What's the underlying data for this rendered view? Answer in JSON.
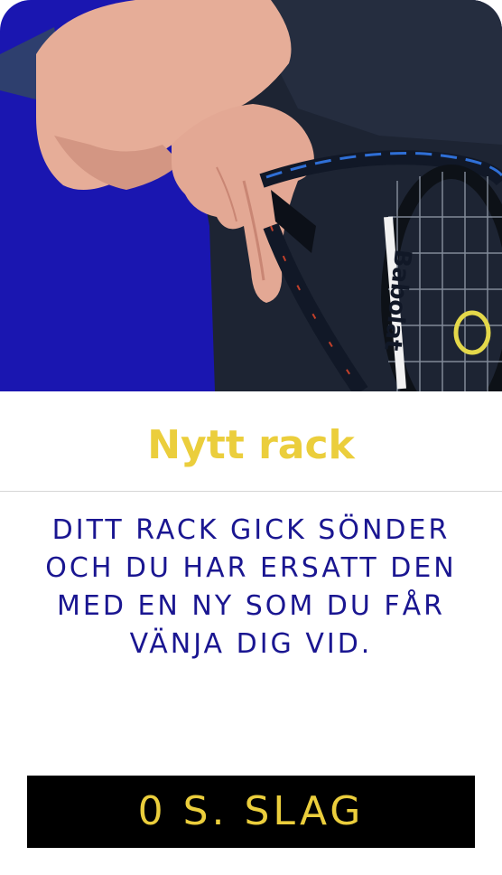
{
  "card": {
    "title": "Nytt rack",
    "description": "DITT RACK GICK SÖNDER OCH DU HAR ERSATT DEN MED EN NY SOM DU FÅR VÄNJA DIG VID.",
    "footer_label": "0 S. SLAG"
  },
  "photo": {
    "racket_brand": "Babolat"
  },
  "colors": {
    "background_blue": "#1a16b0",
    "title_yellow": "#ebce3c",
    "text_navy": "#1a1691",
    "footer_black": "#000000"
  }
}
